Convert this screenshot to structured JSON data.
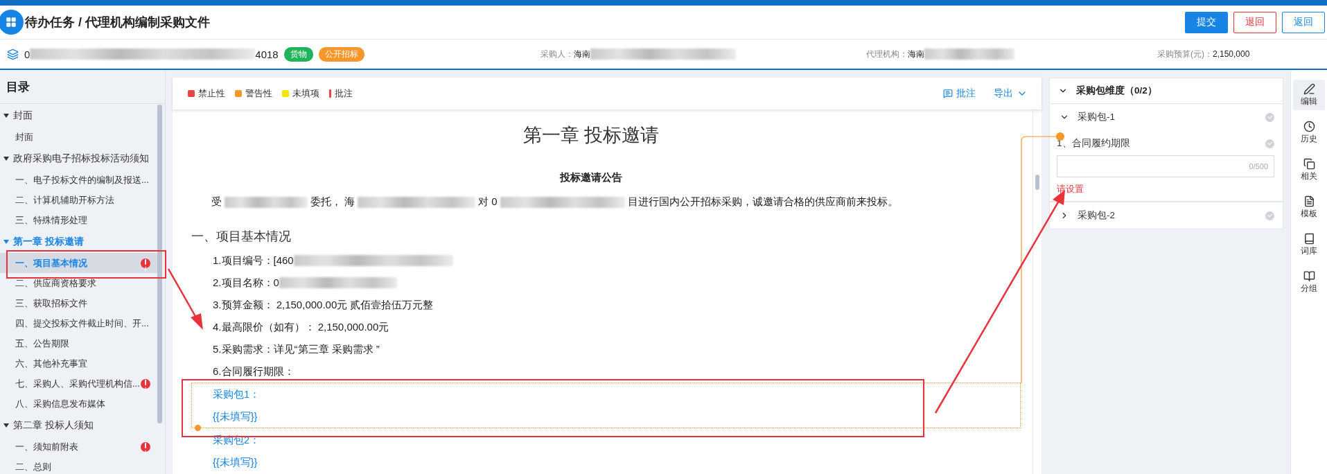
{
  "header": {
    "title": "待办任务 / 代理机构编制采购文件",
    "buttons": [
      {
        "label": "提交",
        "kind": "primary"
      },
      {
        "label": "退回",
        "kind": "danger"
      },
      {
        "label": "返回",
        "kind": "outline"
      }
    ]
  },
  "info": {
    "code": [
      {
        "kind": "text",
        "text": "0"
      },
      {
        "kind": "blur"
      },
      {
        "kind": "text",
        "text": "4018"
      }
    ],
    "tags": [
      {
        "label": "货物",
        "color": "#1fb35b"
      },
      {
        "label": "公开招标",
        "color": "#f7962b"
      }
    ],
    "fields": [
      {
        "label": "采购人：",
        "value": [
          {
            "kind": "text",
            "text": "海南"
          },
          {
            "kind": "blur"
          }
        ]
      },
      {
        "label": "代理机构：",
        "value": [
          {
            "kind": "text",
            "text": "海南"
          },
          {
            "kind": "blur"
          }
        ]
      },
      {
        "label": "采购预算(元)：",
        "value": [
          {
            "kind": "text",
            "text": "2,150,000"
          }
        ]
      }
    ]
  },
  "sidebar": {
    "title": "目录",
    "items": [
      {
        "label": "封面",
        "expanded": true,
        "children": [
          {
            "label": "封面",
            "selected": false,
            "alert": false
          }
        ]
      },
      {
        "label": "政府采购电子招标投标活动须知",
        "expanded": true,
        "children": [
          {
            "label": "一、电子投标文件的编制及报送...",
            "selected": false,
            "alert": false
          },
          {
            "label": "二、计算机辅助开标方法",
            "selected": false,
            "alert": false
          },
          {
            "label": "三、特殊情形处理",
            "selected": false,
            "alert": false
          }
        ]
      },
      {
        "label": "第一章 投标邀请",
        "expanded": true,
        "children": [
          {
            "label": "一、项目基本情况",
            "selected": true,
            "alert": true
          },
          {
            "label": "二、供应商资格要求",
            "selected": false,
            "alert": false
          },
          {
            "label": "三、获取招标文件",
            "selected": false,
            "alert": false
          },
          {
            "label": "四、提交投标文件截止时间、开...",
            "selected": false,
            "alert": false
          },
          {
            "label": "五、公告期限",
            "selected": false,
            "alert": false
          },
          {
            "label": "六、其他补充事宜",
            "selected": false,
            "alert": false
          },
          {
            "label": "七、采购人、采购代理机构信...",
            "selected": false,
            "alert": true
          },
          {
            "label": "八、采购信息发布媒体",
            "selected": false,
            "alert": false
          }
        ]
      },
      {
        "label": "第二章 投标人须知",
        "expanded": true,
        "children": [
          {
            "label": "一、须知前附表",
            "selected": false,
            "alert": true
          },
          {
            "label": "二、总则",
            "selected": false,
            "alert": false
          }
        ]
      }
    ]
  },
  "toolbar": {
    "legend": [
      {
        "label": "禁止性",
        "color": "#e84545",
        "kind": "square"
      },
      {
        "label": "警告性",
        "color": "#f7962b",
        "kind": "square"
      },
      {
        "label": "未填项",
        "color": "#f5e400",
        "kind": "square"
      },
      {
        "label": "批注",
        "color": "#e84545",
        "kind": "bar"
      }
    ],
    "actions": [
      {
        "label": "批注",
        "kind": "comment"
      },
      {
        "label": "导出",
        "kind": "dropdown"
      }
    ]
  },
  "document": {
    "title": "第一章 投标邀请",
    "notice_title": "投标邀请公告",
    "intro": [
      {
        "kind": "text",
        "text": "受"
      },
      {
        "kind": "blur"
      },
      {
        "kind": "text",
        "text": "委托，"
      },
      {
        "kind": "text",
        "text": "海"
      },
      {
        "kind": "blur"
      },
      {
        "kind": "text",
        "text": "对 0"
      },
      {
        "kind": "blur"
      },
      {
        "kind": "text",
        "text": "目进行国内公开招标采购，诚邀请合格的供应商前来投标。"
      }
    ],
    "section": "一、项目基本情况",
    "items": [
      [
        {
          "kind": "text",
          "text": "1.项目编号：[460"
        },
        {
          "kind": "blur"
        }
      ],
      [
        {
          "kind": "text",
          "text": "2.项目名称：0"
        },
        {
          "kind": "blur"
        }
      ],
      [
        {
          "kind": "text",
          "text": "3.预算金额：  2,150,000.00元 贰佰壹拾伍万元整"
        }
      ],
      [
        {
          "kind": "text",
          "text": "4.最高限价（如有）：  2,150,000.00元"
        }
      ],
      [
        {
          "kind": "text",
          "text": "5.采购需求：详见“第三章 采购需求 ”"
        }
      ],
      [
        {
          "kind": "text",
          "text": "6.合同履行期限："
        }
      ]
    ],
    "packages": [
      {
        "label": "采购包1：",
        "value": "{{未填写}}",
        "highlighted": true
      },
      {
        "label": "采购包2：",
        "value": "{{未填写}}",
        "highlighted": false
      }
    ]
  },
  "panel": {
    "title": "采购包维度（0/2）",
    "expanded": true,
    "packages": [
      {
        "label": "采购包-1",
        "expanded": true,
        "done": false,
        "fields": [
          {
            "label": "1、合同履约期限",
            "done": false,
            "counter": "0/500",
            "error": "请设置"
          }
        ]
      },
      {
        "label": "采购包-2",
        "expanded": false,
        "done": false
      }
    ]
  },
  "rail": [
    {
      "label": "编辑",
      "kind": "edit",
      "selected": true
    },
    {
      "label": "历史",
      "kind": "history",
      "selected": false
    },
    {
      "label": "相关",
      "kind": "related",
      "selected": false
    },
    {
      "label": "模板",
      "kind": "template",
      "selected": false
    },
    {
      "label": "词库",
      "kind": "lexicon",
      "selected": false
    },
    {
      "label": "分组",
      "kind": "group",
      "selected": false
    }
  ]
}
